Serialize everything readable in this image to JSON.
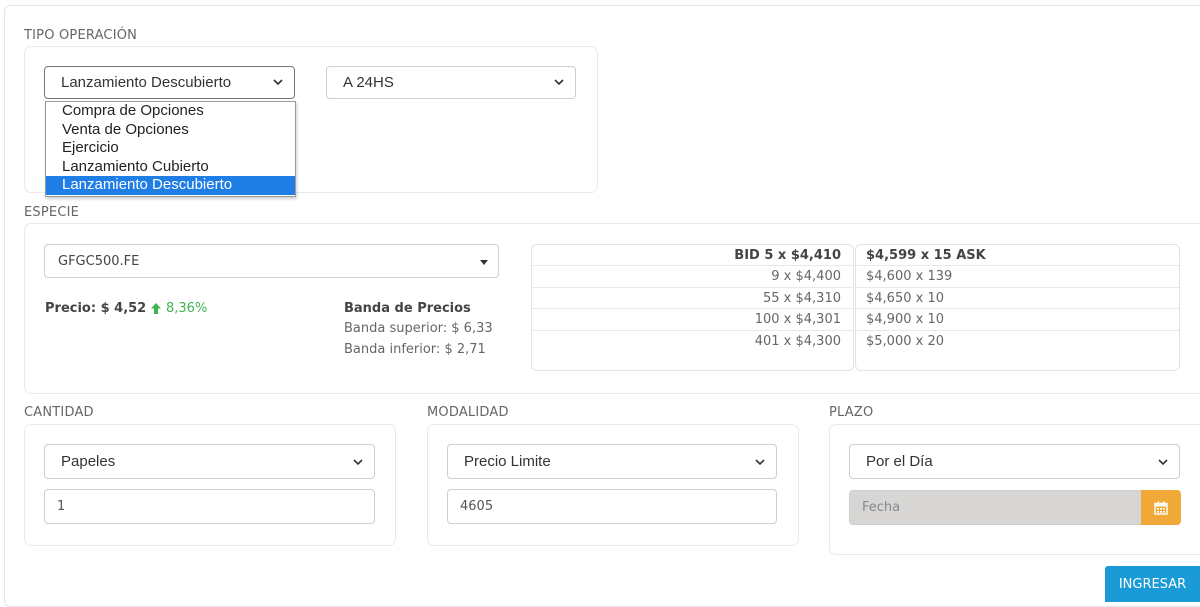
{
  "tipo_operacion": {
    "label": "TIPO OPERACIÓN",
    "operation_select": {
      "value": "Lanzamiento Descubierto"
    },
    "settlement_select": {
      "value": "A 24HS"
    },
    "dropdown_options": [
      {
        "label": "Compra de Opciones"
      },
      {
        "label": "Venta de Opciones"
      },
      {
        "label": "Ejercicio"
      },
      {
        "label": "Lanzamiento Cubierto"
      },
      {
        "label": "Lanzamiento Descubierto"
      }
    ],
    "selected_index": 4
  },
  "especie": {
    "label": "ESPECIE",
    "symbol_select": {
      "value": "GFGC500.FE"
    },
    "price": {
      "label": "Precio: $ 4,52",
      "change": "8,36%",
      "change_color": "#3fb34f"
    },
    "banda": {
      "title": "Banda de Precios",
      "superior": "Banda superior: $ 6,33",
      "inferior": "Banda inferior: $ 2,71"
    },
    "book": {
      "bid": [
        "BID 5 x $4,410",
        "9 x $4,400",
        "55 x $4,310",
        "100 x $4,301",
        "401 x $4,300"
      ],
      "ask": [
        "$4,599 x 15 ASK",
        "$4,600 x 139",
        "$4,650 x 10",
        "$4,900 x 10",
        "$5,000 x 20"
      ]
    }
  },
  "cantidad": {
    "label": "CANTIDAD",
    "unit_select": {
      "value": "Papeles"
    },
    "quantity_input": {
      "value": "1"
    }
  },
  "modalidad": {
    "label": "MODALIDAD",
    "mode_select": {
      "value": "Precio Limite"
    },
    "price_input": {
      "value": "4605"
    }
  },
  "plazo": {
    "label": "PLAZO",
    "term_select": {
      "value": "Por el Día"
    },
    "date_input": {
      "placeholder": "Fecha"
    }
  },
  "submit": {
    "label": "INGRESAR"
  },
  "colors": {
    "accent": "#1a9ad6",
    "calendar": "#f0a938",
    "selected_option": "#1e7ee6"
  }
}
